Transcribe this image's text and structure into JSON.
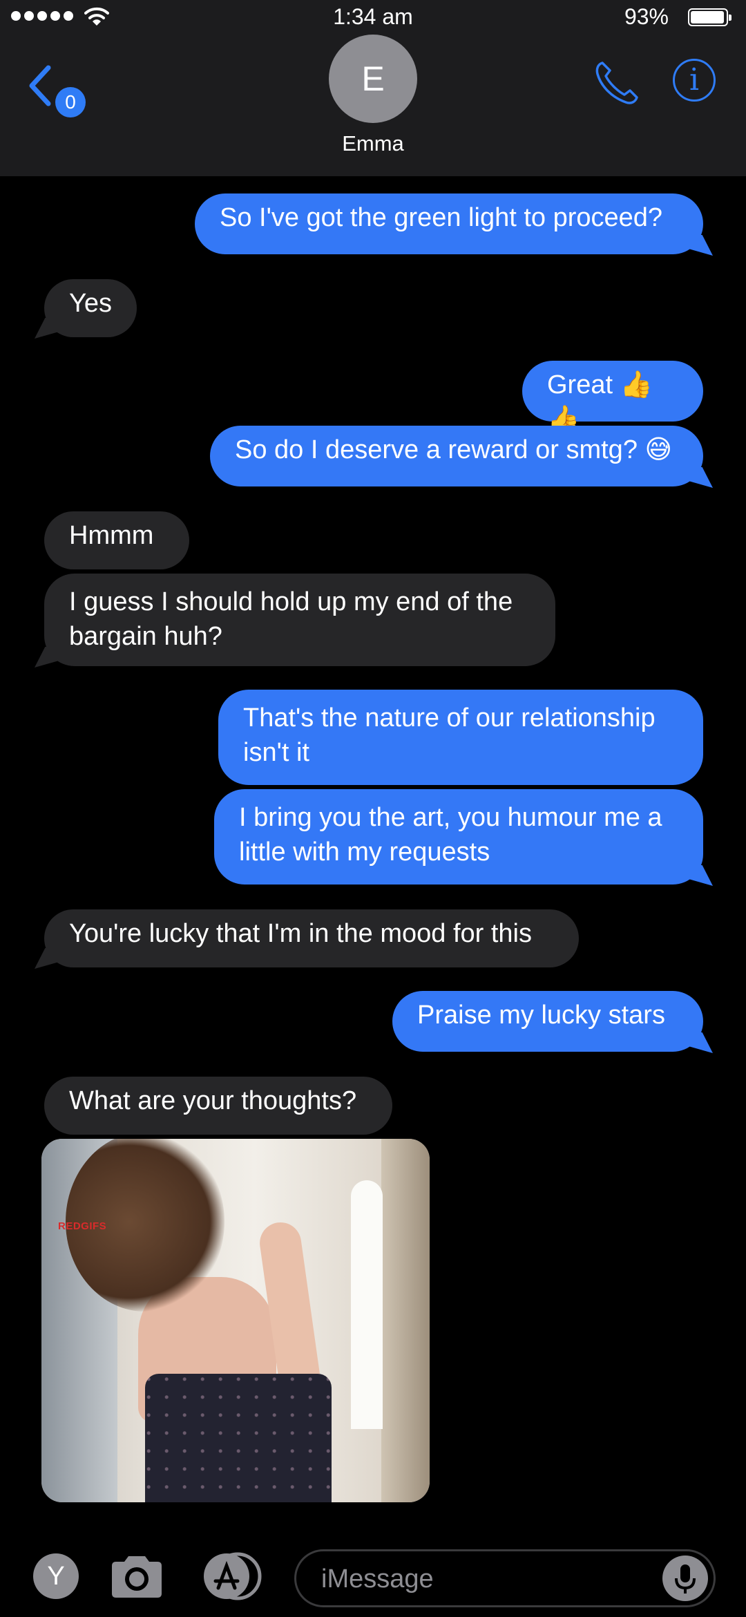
{
  "status_bar": {
    "time": "1:34 am",
    "battery": "93%"
  },
  "header": {
    "back_badge": "0",
    "avatar_initial": "E",
    "contact_name": "Emma"
  },
  "messages": [
    {
      "text": "So I've got the green light to proceed?",
      "from": "me"
    },
    {
      "text": "Yes",
      "from": "them"
    },
    {
      "text": "Great 👍👍",
      "from": "me"
    },
    {
      "text": "So do I deserve a reward or smtg? 😅",
      "from": "me"
    },
    {
      "text": "Hmmm",
      "from": "them"
    },
    {
      "text": "I guess I should hold up my end of the bargain huh?",
      "from": "them"
    },
    {
      "text": "That's the nature of our relationship isn't it",
      "from": "me"
    },
    {
      "text": "I bring you the art, you humour me a little with my requests",
      "from": "me"
    },
    {
      "text": "You're lucky that I'm in the mood for this",
      "from": "them"
    },
    {
      "text": "Praise my lucky stars",
      "from": "me"
    },
    {
      "text": "What are your thoughts?",
      "from": "them"
    }
  ],
  "photo": {
    "watermark": "REDGIFS"
  },
  "input_bar": {
    "app_initial": "Y",
    "placeholder": "iMessage"
  },
  "colors": {
    "sent": "#3478f6",
    "received": "#262628",
    "accent": "#2f7cf6",
    "header_bg": "#1c1c1e"
  }
}
